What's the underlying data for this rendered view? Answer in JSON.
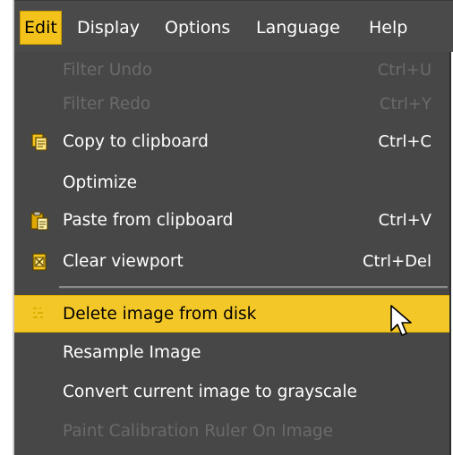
{
  "menubar": {
    "items": [
      {
        "label": "Edit",
        "active": true
      },
      {
        "label": "Display"
      },
      {
        "label": "Options"
      },
      {
        "label": "Language"
      },
      {
        "label": "Help"
      }
    ]
  },
  "edit_menu": {
    "items": [
      {
        "label": "Filter Undo",
        "shortcut": "Ctrl+U",
        "enabled": false
      },
      {
        "label": "Filter Redo",
        "shortcut": "Ctrl+Y",
        "enabled": false
      },
      {
        "label": "Copy to clipboard",
        "shortcut": "Ctrl+C",
        "icon": "copy-icon",
        "enabled": true
      },
      {
        "label": "Optimize",
        "shortcut": "",
        "enabled": true
      },
      {
        "label": "Paste from clipboard",
        "shortcut": "Ctrl+V",
        "icon": "paste-icon",
        "enabled": true
      },
      {
        "label": "Clear viewport",
        "shortcut": "Ctrl+Del",
        "icon": "clear-viewport-icon",
        "enabled": true
      },
      {
        "label": "Delete image from disk",
        "shortcut": "",
        "icon": "delete-icon",
        "enabled": true,
        "highlighted": true
      },
      {
        "label": "Resample Image",
        "shortcut": "",
        "enabled": true
      },
      {
        "label": "Convert current image to grayscale",
        "shortcut": "",
        "enabled": true
      },
      {
        "label": "Paint Calibration Ruler On Image",
        "shortcut": "",
        "enabled": false
      }
    ]
  },
  "colors": {
    "menu_background": "#474747",
    "highlight": "#f4c729",
    "disabled_text": "#6a6a6a"
  },
  "cursor": "mouse-pointer-icon"
}
